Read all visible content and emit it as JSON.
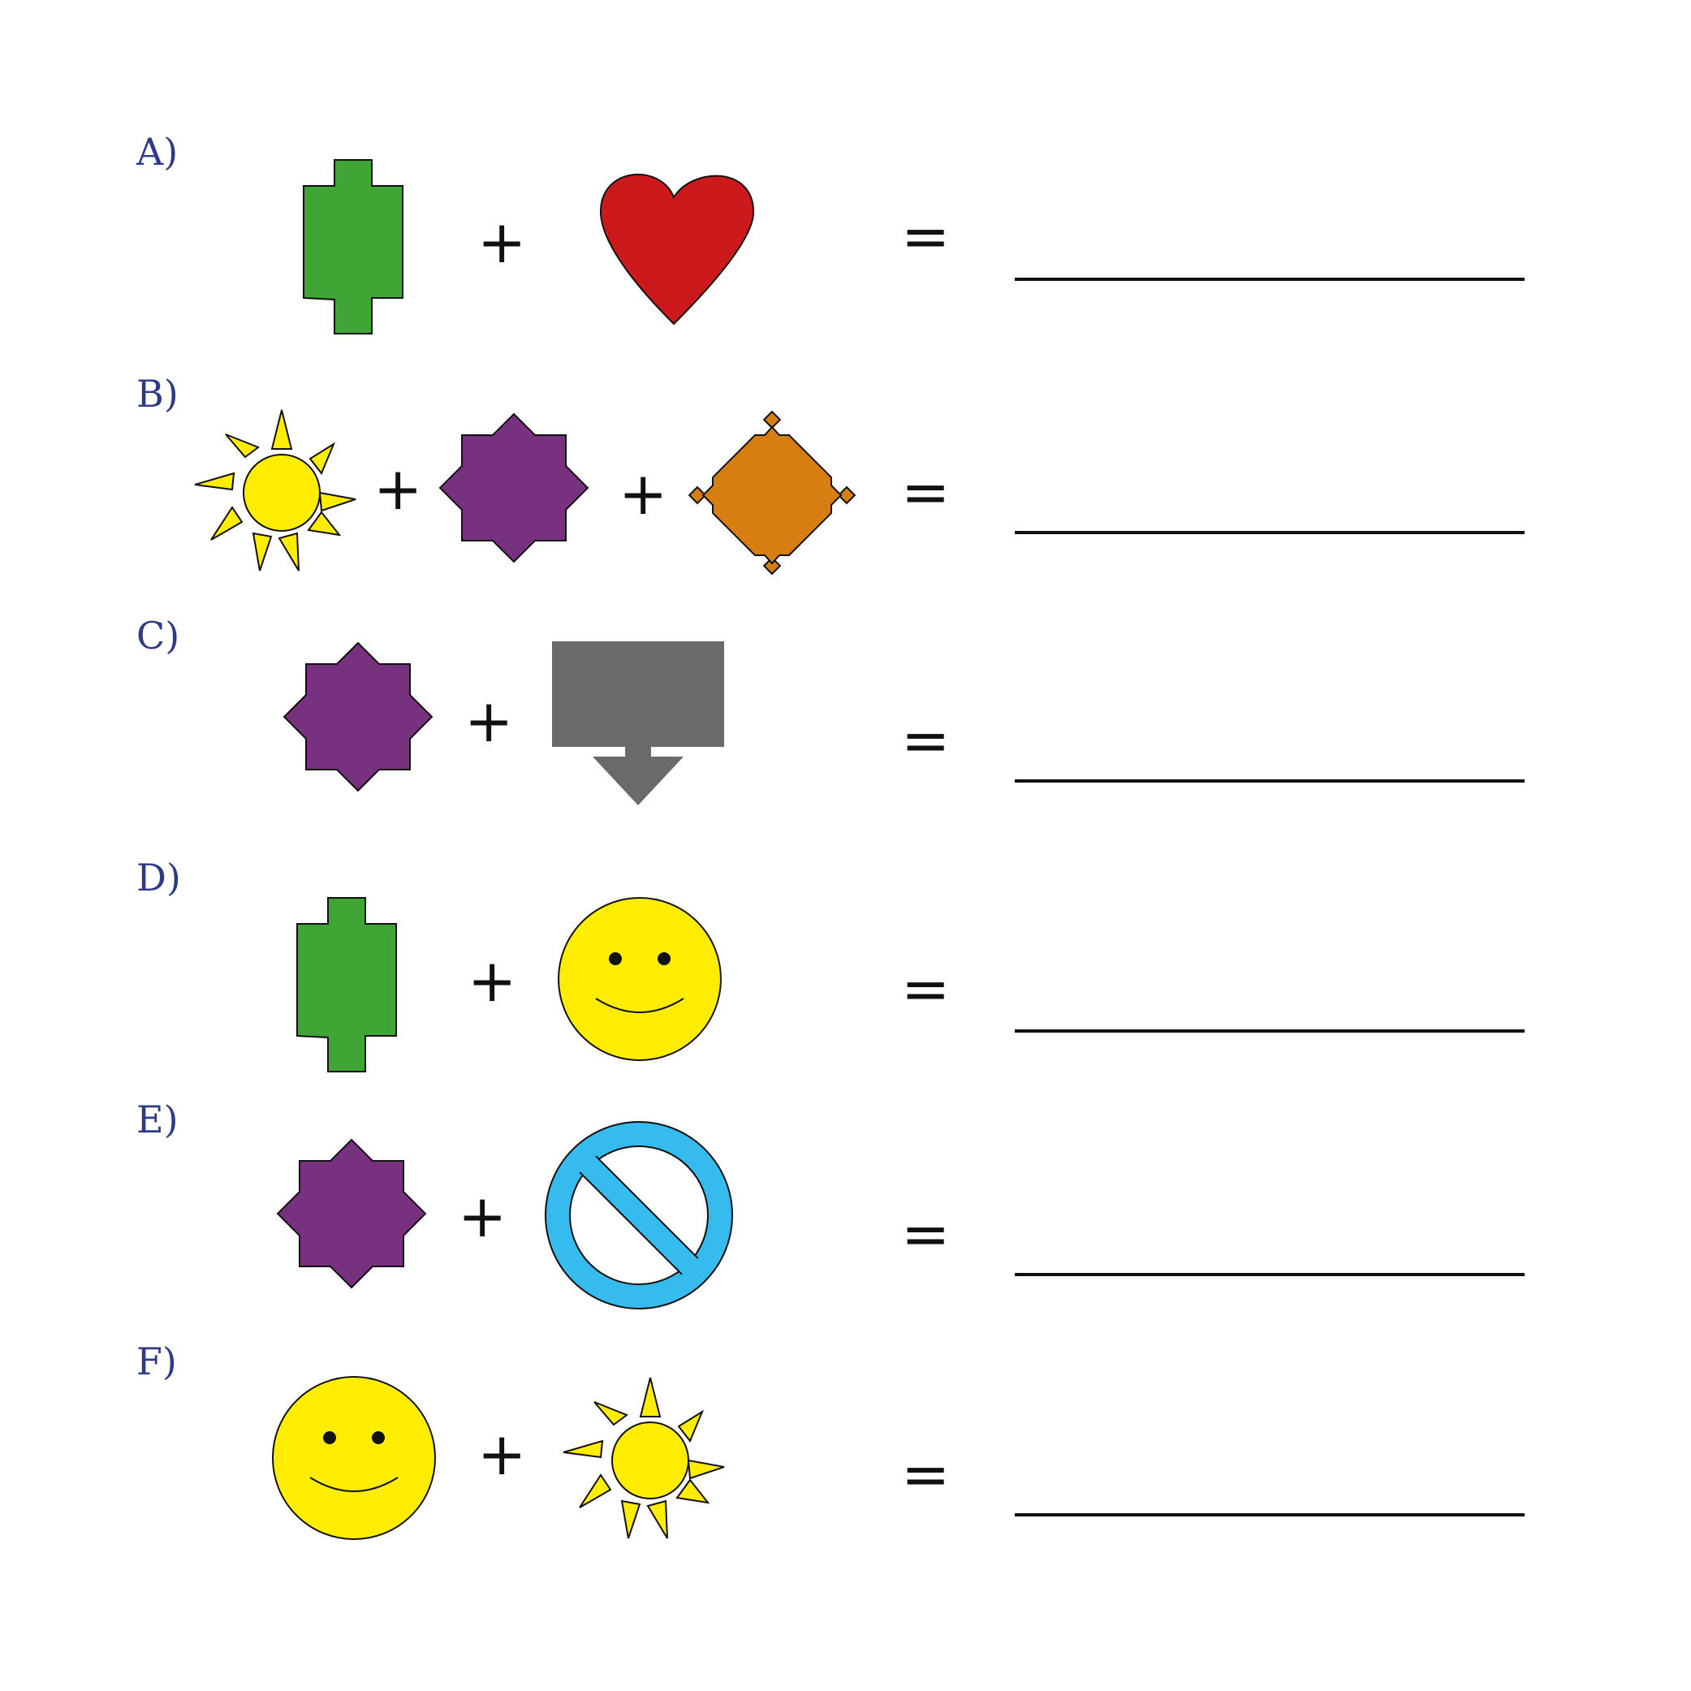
{
  "rows": [
    {
      "label": "A)",
      "shapes": [
        "green-block-icon",
        "heart-icon"
      ]
    },
    {
      "label": "B)",
      "shapes": [
        "sun-icon",
        "purple-star-icon",
        "orange-gear-icon"
      ]
    },
    {
      "label": "C)",
      "shapes": [
        "purple-star-icon",
        "gray-sign-arrow-icon"
      ]
    },
    {
      "label": "D)",
      "shapes": [
        "green-block-icon",
        "smiley-face-icon"
      ]
    },
    {
      "label": "E)",
      "shapes": [
        "purple-star-icon",
        "prohibition-sign-icon"
      ]
    },
    {
      "label": "F)",
      "shapes": [
        "smiley-face-icon",
        "sun-icon"
      ]
    }
  ],
  "operators": {
    "plus": "+",
    "equals": "="
  },
  "colors": {
    "label_text": "#2e3a87",
    "green": "#3fa535",
    "red": "#cc1a1c",
    "yellow": "#ffed00",
    "purple": "#78317f",
    "orange": "#d67e12",
    "gray": "#6a6a69",
    "blue": "#35bbed"
  }
}
